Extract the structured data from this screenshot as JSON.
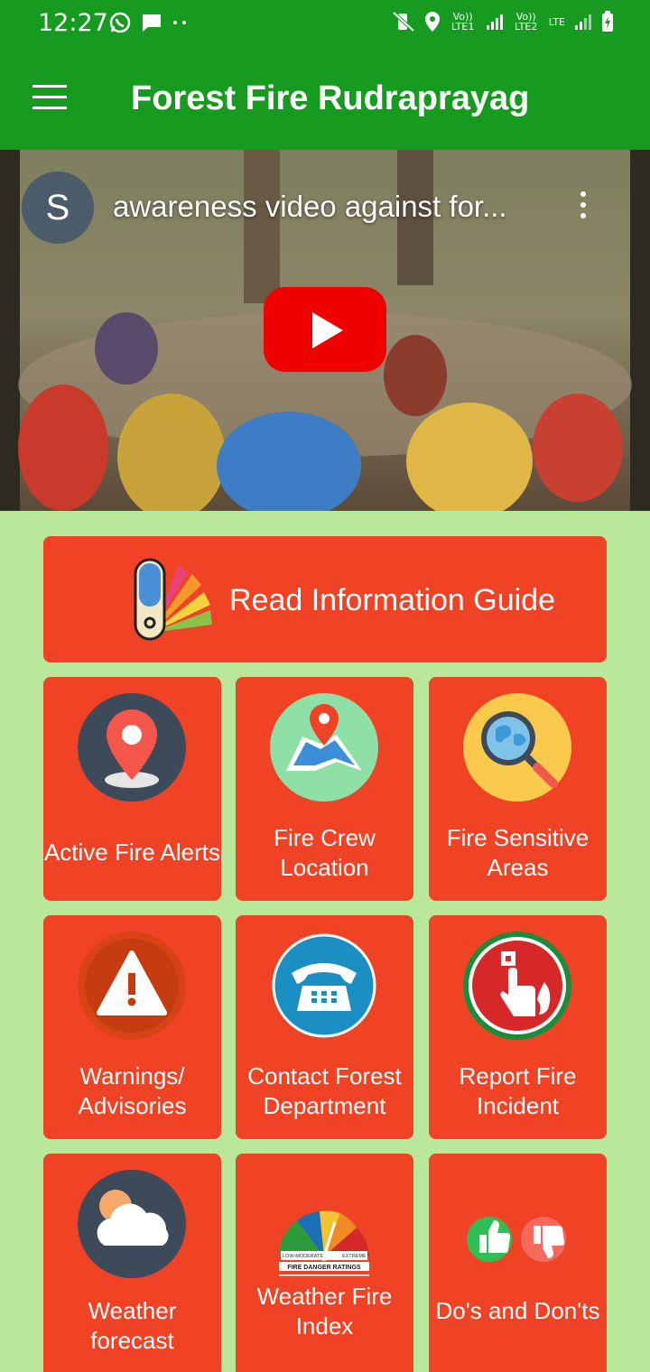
{
  "status": {
    "time": "12:27",
    "lte1": "Vo)) LTE1",
    "lte2": "Vo)) LTE2",
    "lte": "LTE"
  },
  "appbar": {
    "title": "Forest Fire Rudraprayag"
  },
  "video": {
    "channel_initial": "S",
    "title": "awareness video against for..."
  },
  "guide": {
    "label": "Read Information Guide"
  },
  "tiles": [
    {
      "label": "Active Fire Alerts",
      "icon": "location-pin-icon"
    },
    {
      "label": "Fire Crew Location",
      "icon": "map-icon"
    },
    {
      "label": "Fire Sensitive Areas",
      "icon": "globe-search-icon"
    },
    {
      "label": "Warnings/ Advisories",
      "icon": "warning-icon"
    },
    {
      "label": "Contact Forest Department",
      "icon": "telephone-icon"
    },
    {
      "label": "Report Fire Incident",
      "icon": "fire-alarm-icon"
    },
    {
      "label": "Weather forecast",
      "icon": "weather-icon"
    },
    {
      "label": "Weather Fire Index",
      "icon": "fire-danger-gauge-icon"
    },
    {
      "label": "Do's and Don'ts",
      "icon": "thumbs-icon"
    }
  ],
  "gauge": {
    "title": "FIRE DANGER RATINGS",
    "low": "LOW-MODERATE",
    "extreme": "EXTREME"
  },
  "colors": {
    "appbar": "#169a20",
    "tile": "#f04224",
    "background": "#b9e89a"
  }
}
